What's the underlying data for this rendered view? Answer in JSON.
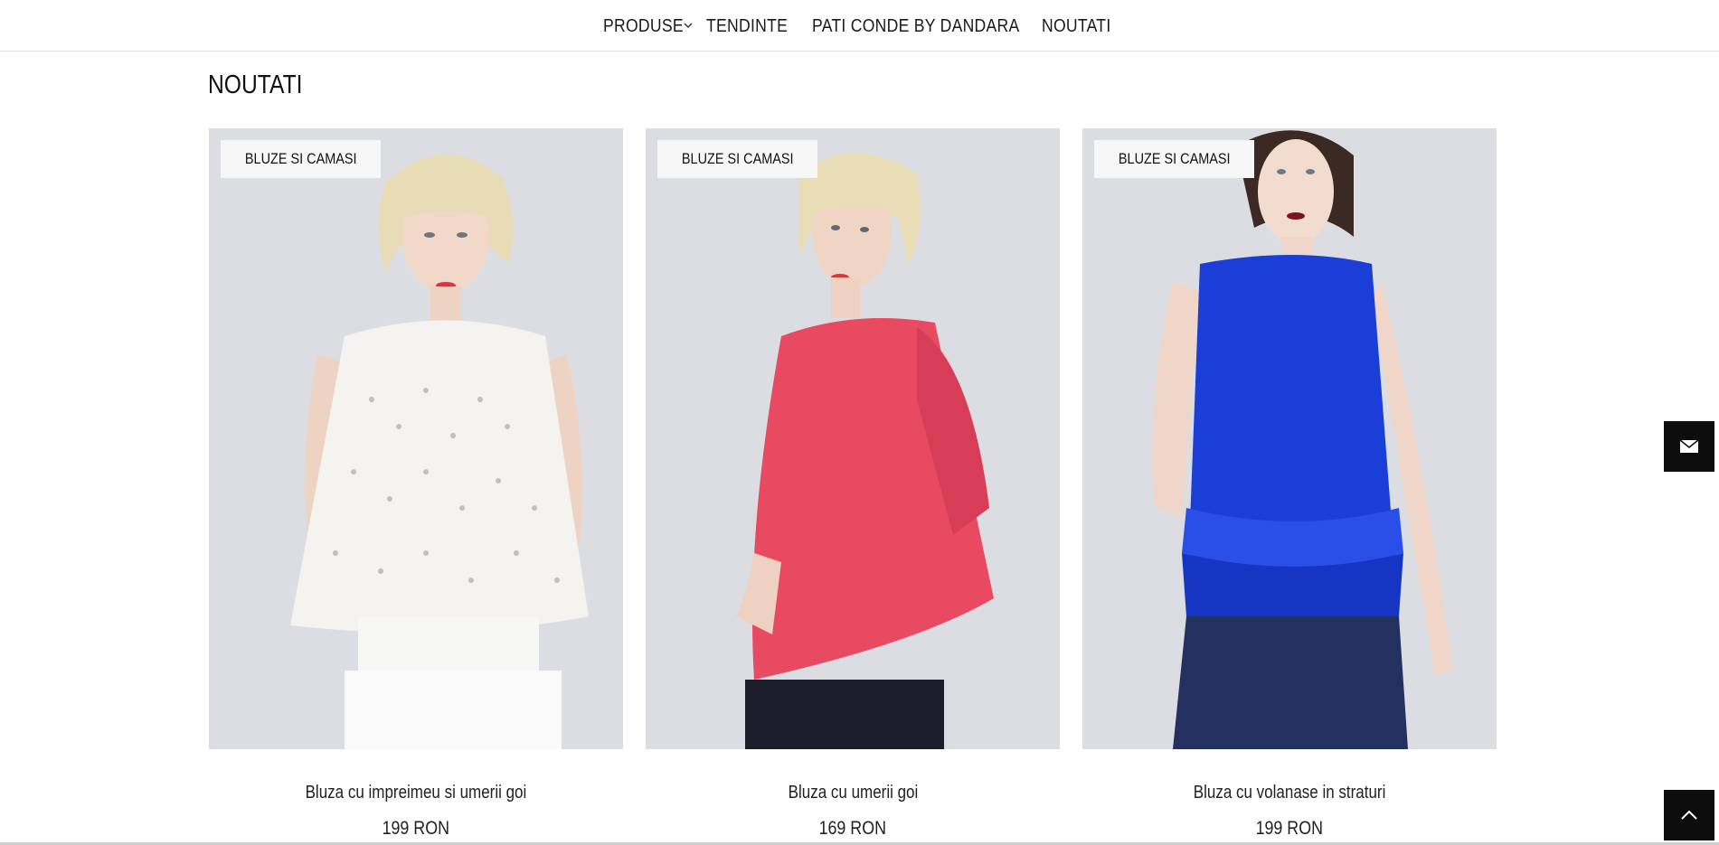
{
  "nav": {
    "items": [
      {
        "label": "PRODUSE",
        "has_dropdown": true
      },
      {
        "label": "TENDINTE"
      },
      {
        "label": "PATI CONDE BY DANDARA"
      },
      {
        "label": "NOUTATI"
      }
    ]
  },
  "page": {
    "title": "NOUTATI"
  },
  "products": [
    {
      "badge": "BLUZE SI CAMASI",
      "name": "Bluza cu impreimeu si umerii goi",
      "price": "199 RON",
      "garment_color": "#f4f3ef"
    },
    {
      "badge": "BLUZE SI CAMASI",
      "name": "Bluza cu umerii goi",
      "price": "169 RON",
      "garment_color": "#e84a62"
    },
    {
      "badge": "BLUZE SI CAMASI",
      "name": "Bluza cu volanase in straturi",
      "price": "199 RON",
      "garment_color": "#1b3fd6"
    }
  ],
  "side_buttons": {
    "contact_icon": "envelope-icon",
    "scroll_top_icon": "chevron-up-icon"
  },
  "colors": {
    "nav_text": "#1a1a1a",
    "image_backdrop": "#dcdde2",
    "button_bg": "#0d0d0d"
  }
}
